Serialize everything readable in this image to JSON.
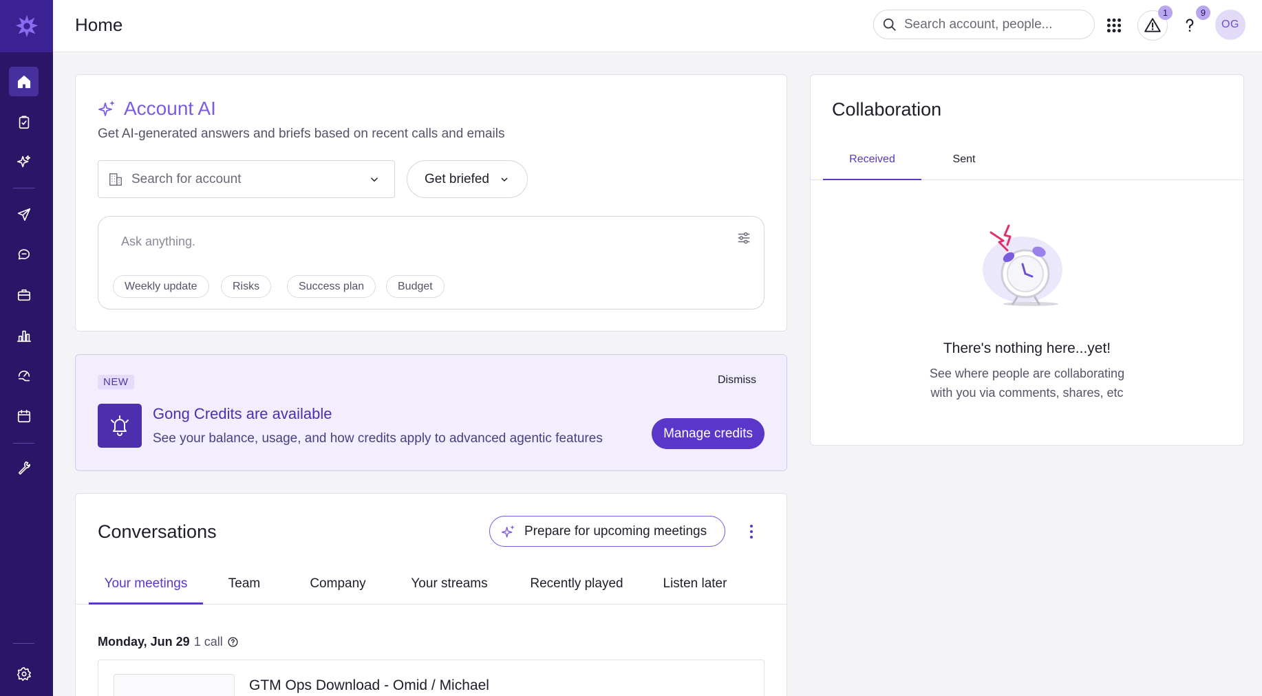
{
  "header": {
    "title": "Home",
    "search_placeholder": "Search account, people...",
    "alerts_count": "1",
    "help_count": "9",
    "avatar_initials": "OG"
  },
  "sidebar": {
    "items": [
      {
        "icon": "home-icon",
        "active": true
      },
      {
        "icon": "clipboard-check-icon"
      },
      {
        "icon": "sparkle-icon"
      },
      {
        "icon": "send-icon"
      },
      {
        "icon": "chat-bubbles-icon"
      },
      {
        "icon": "briefcase-icon"
      },
      {
        "icon": "bar-chart-icon"
      },
      {
        "icon": "gauge-hand-icon"
      },
      {
        "icon": "calendar-icon"
      },
      {
        "icon": "wrench-icon"
      },
      {
        "icon": "gear-icon"
      }
    ]
  },
  "account_ai": {
    "title": "Account AI",
    "subtitle": "Get AI-generated answers and briefs based on recent calls and emails",
    "account_placeholder": "Search for account",
    "brief_label": "Get briefed",
    "ask_placeholder": "Ask anything.",
    "chips": [
      "Weekly update",
      "Risks",
      "Success plan",
      "Budget"
    ]
  },
  "credits": {
    "tag": "NEW",
    "dismiss": "Dismiss",
    "title": "Gong Credits are available",
    "subtitle": "See your balance, usage, and how credits apply to advanced agentic features",
    "button": "Manage credits"
  },
  "conversations": {
    "title": "Conversations",
    "prepare_label": "Prepare for upcoming meetings",
    "tabs": [
      "Your meetings",
      "Team",
      "Company",
      "Your streams",
      "Recently played",
      "Listen later"
    ],
    "active_tab": 0,
    "date": "Monday, Jun 29",
    "call_count": "1 call",
    "meeting_title": "GTM Ops Download - Omid / Michael"
  },
  "collaboration": {
    "title": "Collaboration",
    "tabs": [
      "Received",
      "Sent"
    ],
    "empty_title": "There's nothing here...yet!",
    "empty_line1": "See where people are collaborating",
    "empty_line2": "with you via comments, shares, etc"
  },
  "colors": {
    "sidebar_bg": "#2a1566",
    "accent": "#5a36c9",
    "accent_light": "#7c5be0"
  }
}
